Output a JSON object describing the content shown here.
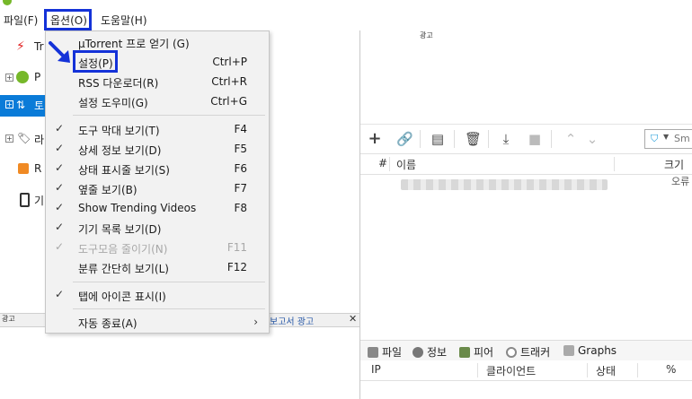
{
  "menubar": {
    "file": "파일(F)",
    "options": "옵션(O)",
    "help": "도움말(H)"
  },
  "dropdown": {
    "items": [
      {
        "label": "µTorrent 프로 얻기 (G)",
        "shortcut": "",
        "checked": false,
        "disabled": false
      },
      {
        "label": "설정(P)",
        "shortcut": "Ctrl+P",
        "checked": false,
        "disabled": false
      },
      {
        "label": "RSS 다운로더(R)",
        "shortcut": "Ctrl+R",
        "checked": false,
        "disabled": false
      },
      {
        "label": "설정 도우미(G)",
        "shortcut": "Ctrl+G",
        "checked": false,
        "disabled": false
      },
      {
        "label": "도구 막대 보기(T)",
        "shortcut": "F4",
        "checked": true,
        "disabled": false
      },
      {
        "label": "상세 정보 보기(D)",
        "shortcut": "F5",
        "checked": true,
        "disabled": false
      },
      {
        "label": "상태 표시줄 보기(S)",
        "shortcut": "F6",
        "checked": true,
        "disabled": false
      },
      {
        "label": "옆줄 보기(B)",
        "shortcut": "F7",
        "checked": true,
        "disabled": false
      },
      {
        "label": "Show Trending Videos",
        "shortcut": "F8",
        "checked": true,
        "disabled": false
      },
      {
        "label": "기기 목록 보기(D)",
        "shortcut": "",
        "checked": true,
        "disabled": false
      },
      {
        "label": "도구모음 줄이기(N)",
        "shortcut": "F11",
        "checked": true,
        "disabled": true
      },
      {
        "label": "분류 간단히 보기(L)",
        "shortcut": "F12",
        "checked": false,
        "disabled": false
      },
      {
        "label": "탭에 아이콘 표시(I)",
        "shortcut": "",
        "checked": true,
        "disabled": false
      },
      {
        "label": "자동 종료(A)",
        "shortcut": "",
        "checked": false,
        "disabled": false,
        "submenu": true
      }
    ]
  },
  "sidebar": {
    "rows": [
      {
        "label": "Tr"
      },
      {
        "label": "P"
      },
      {
        "label": "토"
      },
      {
        "label": "라"
      },
      {
        "label": "R"
      },
      {
        "label": "기"
      }
    ]
  },
  "ad": {
    "top_label": "광고",
    "strip_left": "광고",
    "strip_right": "보고서 광고"
  },
  "search": {
    "placeholder": "Sm"
  },
  "list": {
    "col_num": "#",
    "col_name": "이름",
    "col_size": "크기",
    "error": "오류"
  },
  "tabs": {
    "files": "파일",
    "info": "정보",
    "peers": "피어",
    "trackers": "트래커",
    "graphs": "Graphs"
  },
  "peers_header": {
    "ip": "IP",
    "client": "클라이언트",
    "status": "상태",
    "percent": "%"
  },
  "colors": {
    "selection": "#0a7bd8",
    "highlight_box": "#1432d8",
    "brand": "#76b82a"
  }
}
